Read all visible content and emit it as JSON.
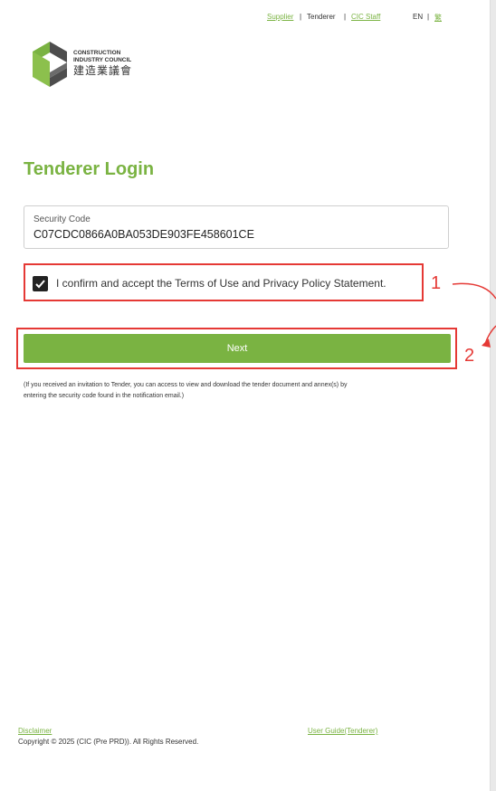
{
  "top_nav": {
    "supplier": "Supplier",
    "separator": "|",
    "tenderer": "Tenderer",
    "cic_staff": "CIC Staff",
    "lang_en": "EN",
    "lang_tc": "繁"
  },
  "logo": {
    "line1": "CONSTRUCTION",
    "line2": "INDUSTRY COUNCIL",
    "chinese": "建造業議會"
  },
  "page": {
    "title": "Tenderer Login"
  },
  "security_code": {
    "label": "Security Code",
    "value": "C07CDC0866A0BA053DE903FE458601CE"
  },
  "consent": {
    "checked": true,
    "text": "I confirm and accept the Terms of Use and Privacy Policy Statement."
  },
  "next_button": {
    "label": "Next"
  },
  "info_note": {
    "line1": "(If you received an invitation to Tender, you can access to view and download the tender document and annex(s) by",
    "line2": "entering the security code found in the notification email.)"
  },
  "annotations": {
    "one": "1",
    "two": "2",
    "color": "#e53935"
  },
  "footer": {
    "disclaimer": "Disclaimer",
    "user_guide": "User Guide(Tenderer)",
    "copyright": "Copyright © 2025 (CIC (Pre PRD)). All Rights Reserved."
  },
  "colors": {
    "brand_green": "#7ab342",
    "highlight_red": "#e53935"
  },
  "icons": {
    "checkbox": "check-icon",
    "logo": "cic-logo-icon"
  }
}
